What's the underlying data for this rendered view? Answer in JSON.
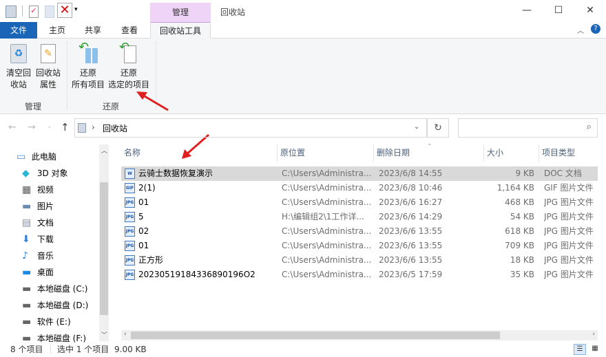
{
  "window": {
    "title": "回收站",
    "context_tab": "管理",
    "minimize": "—",
    "maximize": "☐",
    "close": "✕"
  },
  "ribbon_tabs": [
    "文件",
    "主页",
    "共享",
    "查看",
    "回收站工具"
  ],
  "ribbon": {
    "groups": [
      {
        "label": "管理",
        "buttons": [
          {
            "line1": "清空回",
            "line2": "收站",
            "icon": "empty-recycle-bin-icon"
          },
          {
            "line1": "回收站",
            "line2": "属性",
            "icon": "properties-icon"
          }
        ]
      },
      {
        "label": "还原",
        "buttons": [
          {
            "line1": "还原",
            "line2": "所有项目",
            "icon": "restore-all-icon"
          },
          {
            "line1": "还原",
            "line2": "选定的项目",
            "icon": "restore-selected-icon"
          }
        ]
      }
    ]
  },
  "address": {
    "path": "回收站",
    "search_placeholder": ""
  },
  "nav": [
    {
      "label": "此电脑",
      "icon": "pc-icon"
    },
    {
      "label": "3D 对象",
      "icon": "3d-objects-icon"
    },
    {
      "label": "视频",
      "icon": "video-icon"
    },
    {
      "label": "图片",
      "icon": "pictures-icon"
    },
    {
      "label": "文档",
      "icon": "documents-icon"
    },
    {
      "label": "下载",
      "icon": "download-icon"
    },
    {
      "label": "音乐",
      "icon": "music-icon"
    },
    {
      "label": "桌面",
      "icon": "desktop-icon"
    },
    {
      "label": "本地磁盘 (C:)",
      "icon": "drive-icon"
    },
    {
      "label": "本地磁盘 (D:)",
      "icon": "drive-icon"
    },
    {
      "label": "软件 (E:)",
      "icon": "drive-icon"
    },
    {
      "label": "本地磁盘 (F:)",
      "icon": "drive-icon"
    }
  ],
  "columns": [
    "名称",
    "原位置",
    "删除日期",
    "大小",
    "项目类型"
  ],
  "files": [
    {
      "name": "云骑士数据恢复演示",
      "location": "C:\\Users\\Administra...",
      "date": "2023/6/8 14:55",
      "size": "9 KB",
      "type": "DOC 文档",
      "badge": "W",
      "selected": true
    },
    {
      "name": "2(1)",
      "location": "C:\\Users\\Administra...",
      "date": "2023/6/8 10:46",
      "size": "1,164 KB",
      "type": "GIF 图片文件",
      "badge": "GIF"
    },
    {
      "name": "01",
      "location": "C:\\Users\\Administra...",
      "date": "2023/6/6 16:27",
      "size": "468 KB",
      "type": "JPG 图片文件",
      "badge": "JPG"
    },
    {
      "name": "5",
      "location": "H:\\编辑组2\\1工作详...",
      "date": "2023/6/6 14:29",
      "size": "54 KB",
      "type": "JPG 图片文件",
      "badge": "JPG"
    },
    {
      "name": "02",
      "location": "C:\\Users\\Administra...",
      "date": "2023/6/6 13:55",
      "size": "618 KB",
      "type": "JPG 图片文件",
      "badge": "JPG"
    },
    {
      "name": "01",
      "location": "C:\\Users\\Administra...",
      "date": "2023/6/6 13:55",
      "size": "709 KB",
      "type": "JPG 图片文件",
      "badge": "JPG"
    },
    {
      "name": "正方形",
      "location": "C:\\Users\\Administra...",
      "date": "2023/6/6 13:55",
      "size": "18 KB",
      "type": "JPG 图片文件",
      "badge": "JPG"
    },
    {
      "name": "20230519184336890196O2",
      "location": "C:\\Users\\Administra...",
      "date": "2023/6/5 17:59",
      "size": "35 KB",
      "type": "JPG 图片文件",
      "badge": "JPG"
    }
  ],
  "status": {
    "count": "8 个项目",
    "selected": "选中 1 个项目",
    "size": "9.00 KB"
  }
}
